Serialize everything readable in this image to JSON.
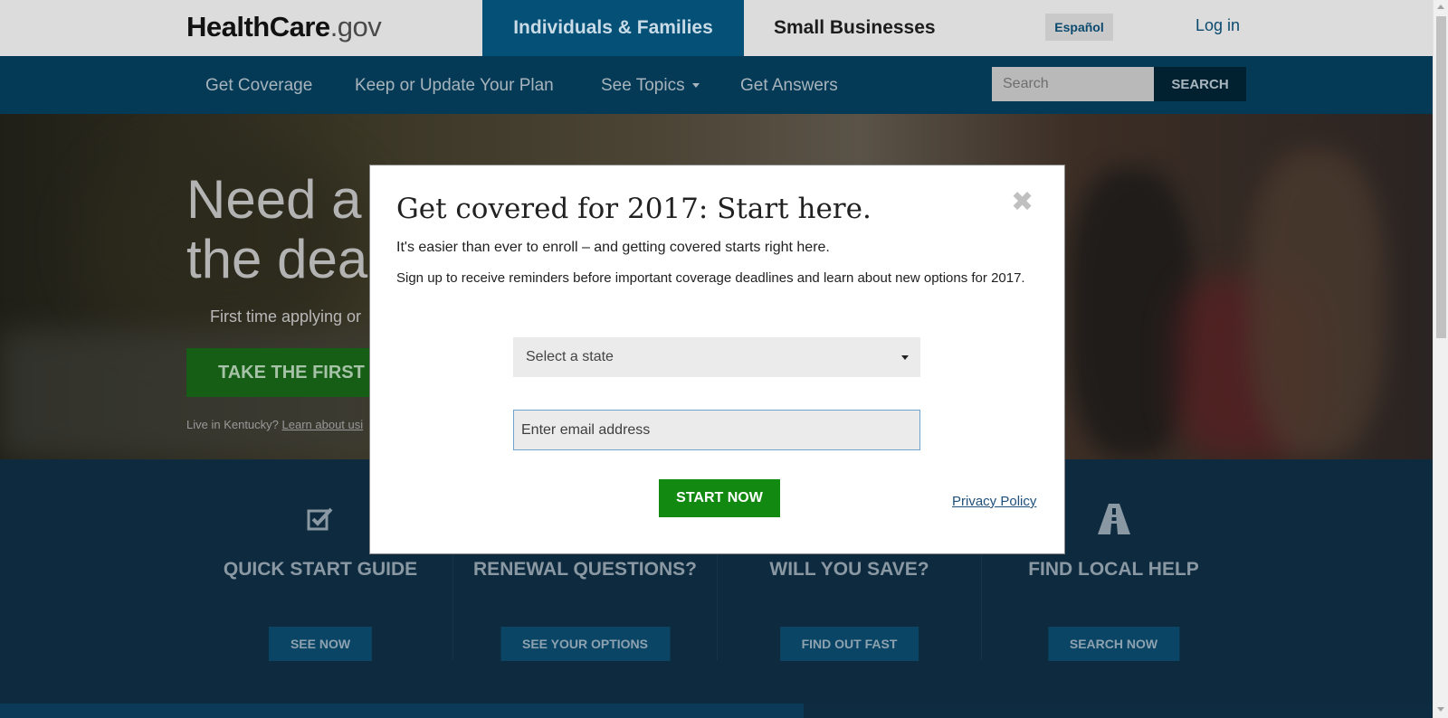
{
  "header": {
    "logo_strong": "HealthCare",
    "logo_light": ".gov",
    "tab_individuals": "Individuals & Families",
    "tab_small_business": "Small Businesses",
    "espanol": "Español",
    "login": "Log in"
  },
  "nav": {
    "items": [
      "Get Coverage",
      "Keep or Update Your Plan",
      "See Topics",
      "Get Answers"
    ],
    "search_placeholder": "Search",
    "search_button": "SEARCH"
  },
  "hero": {
    "headline_line1": "Need a",
    "headline_line2": "the dea",
    "subtext": "First time applying or",
    "cta": "TAKE THE FIRST S",
    "ky_prefix": "Live in Kentucky?",
    "ky_link": "Learn about usi"
  },
  "features": [
    {
      "icon": "checkbox-icon",
      "title": "QUICK START GUIDE",
      "button": "SEE NOW"
    },
    {
      "icon": "refresh-icon",
      "title": "RENEWAL QUESTIONS?",
      "button": "SEE YOUR OPTIONS"
    },
    {
      "icon": "piggy-bank-icon",
      "title": "WILL YOU SAVE?",
      "button": "FIND OUT FAST"
    },
    {
      "icon": "road-icon",
      "title": "FIND LOCAL HELP",
      "button": "SEARCH NOW"
    }
  ],
  "modal": {
    "title": "Get covered for 2017: Start here.",
    "close_symbol": "✖",
    "p1": "It's easier than ever to enroll – and getting covered starts right here.",
    "p2": "Sign up to receive reminders before important coverage deadlines and learn about new options for 2017.",
    "state_placeholder": "Select a state",
    "email_placeholder": "Enter email address",
    "start_button": "START NOW",
    "privacy_link": "Privacy Policy"
  },
  "colors": {
    "topbar": "#dcdcdc",
    "nav": "#043a55",
    "active_tab": "#045077",
    "green": "#128a12",
    "feature_bg": "#0d2a3e"
  }
}
